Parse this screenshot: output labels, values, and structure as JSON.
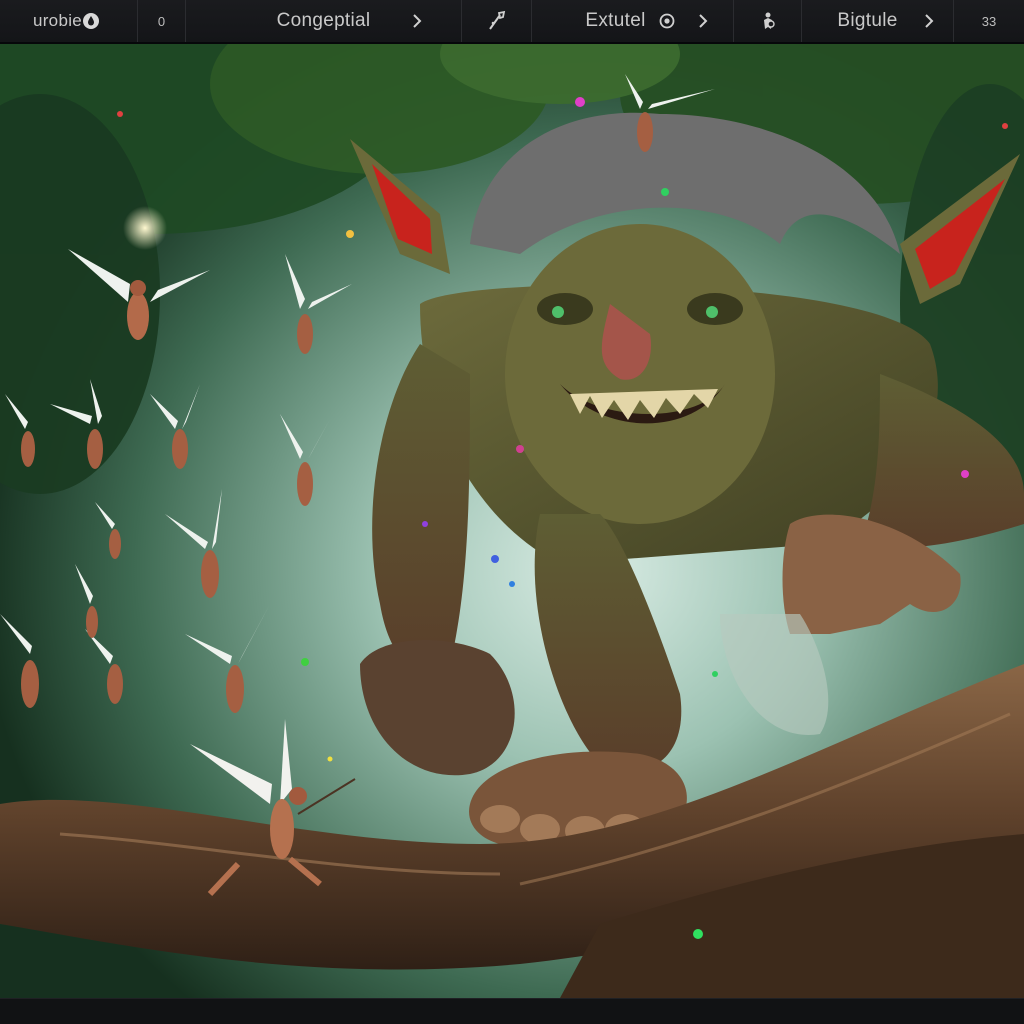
{
  "toolbar": {
    "item1_label": "urobie",
    "item2_value": "0",
    "item3_label": "Congeptial",
    "item4_label": "Extutel",
    "item5_label": "Bigtule",
    "item6_value": "33"
  },
  "icons": {
    "drop": "drop-icon",
    "chevron": "chevron-right-icon",
    "brush": "brush-icon",
    "target": "target-icon",
    "figure": "figure-icon"
  },
  "colors": {
    "toolbar_bg": "#17181b",
    "toolbar_text": "#c9c9c9",
    "divider": "#2b2c30",
    "forest_dark": "#173a26",
    "mist": "#a9c9bd",
    "troll_skin": "#5a5a34",
    "ear_red": "#c8231d",
    "branch": "#6a4a31"
  }
}
